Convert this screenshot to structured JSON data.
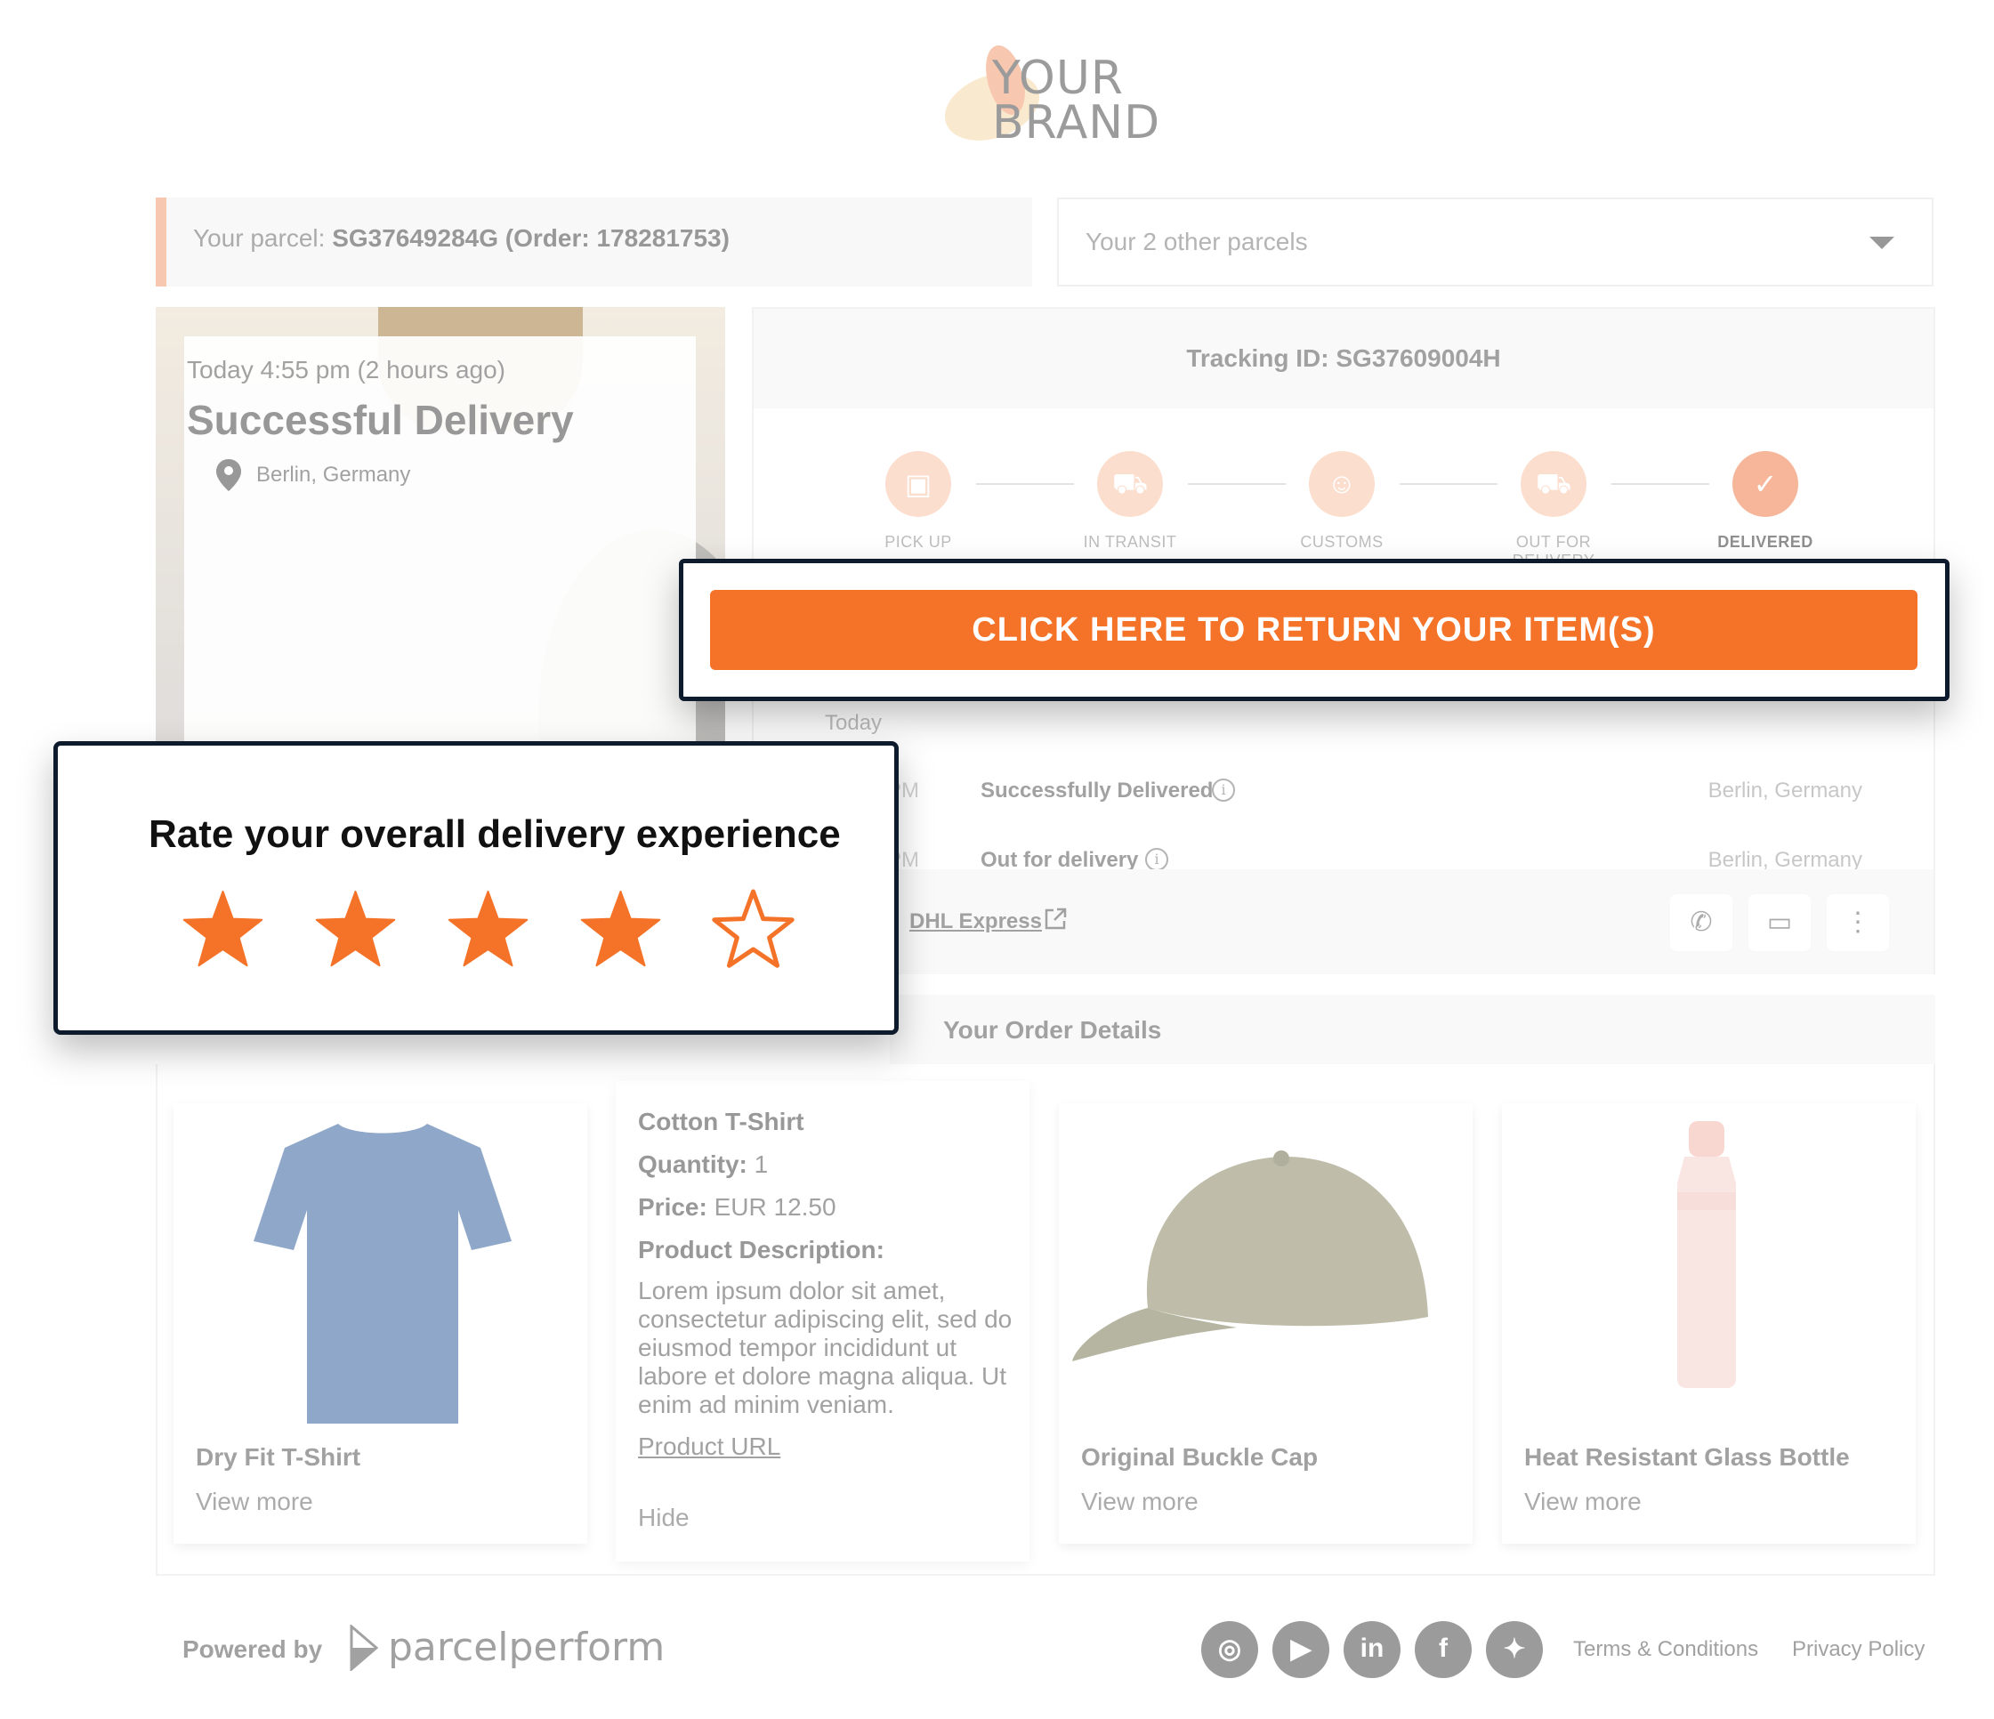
{
  "brand": {
    "line1": "YOUR",
    "line2": "BRAND"
  },
  "parcel_bar": {
    "label": "Your parcel: ",
    "value": "SG37649284G (Order: 178281753)"
  },
  "other_parcels": {
    "label": "Your 2 other parcels",
    "icon": "caret-down-icon"
  },
  "hero": {
    "time": "Today 4:55 pm (2 hours ago)",
    "status": "Successful Delivery",
    "location": "Berlin, Germany"
  },
  "tracking": {
    "title": "Tracking ID: SG37609004H",
    "steps": [
      {
        "label": "PICK UP",
        "icon": "box-icon"
      },
      {
        "label": "IN TRANSIT",
        "icon": "truck-icon"
      },
      {
        "label": "CUSTOMS",
        "icon": "officer-icon"
      },
      {
        "label": "OUT FOR DELIVERY",
        "icon": "delivery-truck-icon"
      },
      {
        "label": "DELIVERED",
        "icon": "checkmark-icon"
      }
    ],
    "events_day": "Today",
    "events": [
      {
        "time": "PM",
        "title": "Successfully Delivered",
        "location": "Berlin, Germany"
      },
      {
        "time": "PM",
        "title": "Out for delivery",
        "location": "Berlin, Germany"
      }
    ],
    "carrier": "DHL Express"
  },
  "return_button": "CLICK HERE TO RETURN YOUR ITEM(S)",
  "rating": {
    "title": "Rate your overall delivery experience",
    "value": 4,
    "max": 5
  },
  "order": {
    "heading": "Your Order Details",
    "products": [
      {
        "name": "Dry Fit T-Shirt",
        "link": "View more"
      },
      {
        "name": "Original Buckle Cap",
        "link": "View more"
      },
      {
        "name": "Heat Resistant Glass Bottle",
        "link": "View more"
      }
    ],
    "detail": {
      "name": "Cotton T-Shirt",
      "quantity_label": "Quantity:",
      "quantity": "1",
      "price_label": "Price:",
      "price": "EUR 12.50",
      "desc_label": "Product Description:",
      "description": "Lorem ipsum dolor sit amet, consectetur adipiscing elit, sed do eiusmod tempor incididunt ut labore et dolore magna aliqua. Ut enim ad minim veniam.",
      "url_label": "Product URL",
      "hide_label": "Hide"
    }
  },
  "footer": {
    "powered_by": "Powered by",
    "logo_text": "parcelperform",
    "social": [
      "instagram-icon",
      "youtube-icon",
      "linkedin-icon",
      "facebook-icon",
      "twitter-icon"
    ],
    "terms": "Terms & Conditions",
    "privacy": "Privacy Policy"
  },
  "colors": {
    "accent": "#f47328",
    "overlay_border": "#0e1b2c",
    "step_done": "#f07a45",
    "step_pending": "#f9c3a6"
  }
}
